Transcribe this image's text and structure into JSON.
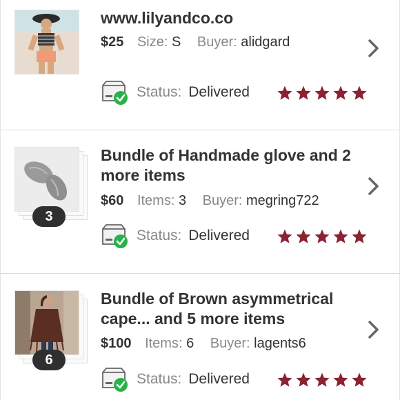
{
  "orders": [
    {
      "title": "www.lilyandco.co",
      "price": "$25",
      "attr_label": "Size:",
      "attr_value": "S",
      "buyer_label": "Buyer:",
      "buyer": "alidgard",
      "status_label": "Status:",
      "status": "Delivered",
      "rating": 5
    },
    {
      "title": "Bundle of Handmade glove and 2 more items",
      "price": "$60",
      "attr_label": "Items:",
      "attr_value": "3",
      "buyer_label": "Buyer:",
      "buyer": "megring722",
      "count_badge": "3",
      "status_label": "Status:",
      "status": "Delivered",
      "rating": 5
    },
    {
      "title": "Bundle of Brown asymmetrical cape... and 5 more items",
      "price": "$100",
      "attr_label": "Items:",
      "attr_value": "6",
      "buyer_label": "Buyer:",
      "buyer": "lagents6",
      "count_badge": "6",
      "status_label": "Status:",
      "status": "Delivered",
      "rating": 5
    }
  ],
  "colors": {
    "star": "#8a2231",
    "check": "#27b24a",
    "chevron": "#666666",
    "badge": "#2f2f2f"
  },
  "icons": {
    "chevron": "chevron-right-icon",
    "status": "delivered-box-icon",
    "star": "star-icon"
  }
}
